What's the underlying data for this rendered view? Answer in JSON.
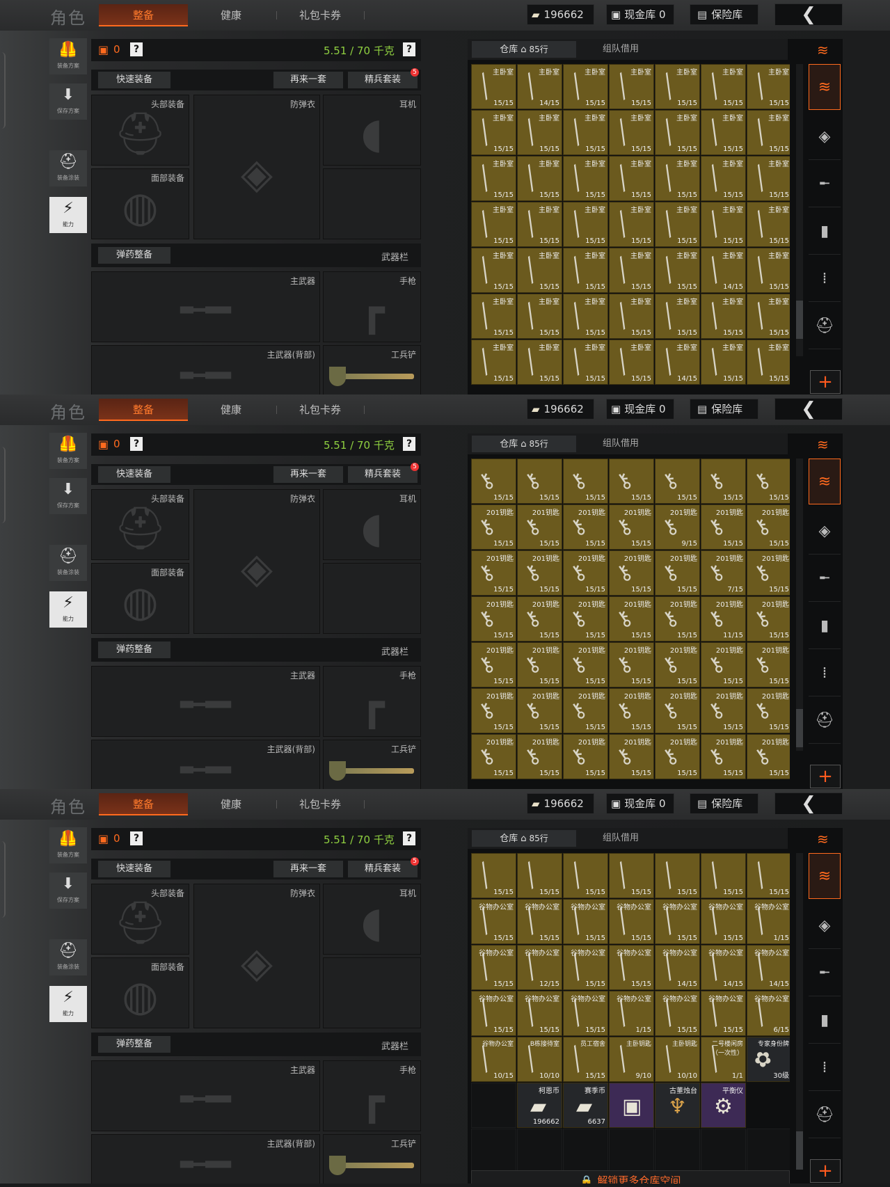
{
  "header": {
    "title": "角色",
    "tabs": [
      "整备",
      "健康",
      "礼包卡券"
    ],
    "currency": "196662",
    "cash_vault": "现金库 0",
    "safe_box": "保险库",
    "back_icon": "chevron-left-icon"
  },
  "sidebar": [
    {
      "label": "装备方案",
      "icon": "vest-icon"
    },
    {
      "label": "保存方案",
      "icon": "download-icon"
    },
    {
      "label": "装备涂装",
      "icon": "helmet-icon"
    },
    {
      "label": "能力",
      "icon": "ability-icon"
    }
  ],
  "loadout": {
    "value": "0",
    "help": "?",
    "weight": "5.51 / 70 千克",
    "quick_equip": "快速装备",
    "again": "再来一套",
    "elite": "精兵套装",
    "elite_badge": "5",
    "slots": {
      "head": "头部装备",
      "armor": "防弹衣",
      "ear": "耳机",
      "face": "面部装备",
      "weapon_bar": "武器栏",
      "ammo": "弹药整备",
      "primary": "主武器",
      "pistol": "手枪",
      "primary_back": "主武器(背部)",
      "shovel": "工兵铲"
    }
  },
  "inventory": {
    "tab_warehouse": "仓库",
    "rows": "85行",
    "tab_team": "组队借用",
    "unlock": "解锁更多仓库空间",
    "categories": [
      "layers-icon",
      "armor-icon",
      "rifle-icon",
      "magazine-icon",
      "ammo-icon",
      "helmet-icon"
    ]
  },
  "screens": [
    {
      "rows": [
        {
          "name": "主卧室",
          "counts": [
            "15/15",
            "14/15",
            "15/15",
            "15/15",
            "15/15",
            "15/15",
            "15/15"
          ]
        },
        {
          "name": "主卧室",
          "counts": [
            "15/15",
            "15/15",
            "15/15",
            "15/15",
            "15/15",
            "15/15",
            "15/15"
          ]
        },
        {
          "name": "主卧室",
          "counts": [
            "15/15",
            "15/15",
            "15/15",
            "15/15",
            "15/15",
            "15/15",
            "15/15"
          ]
        },
        {
          "name": "主卧室",
          "counts": [
            "15/15",
            "15/15",
            "15/15",
            "15/15",
            "15/15",
            "15/15",
            "15/15"
          ]
        },
        {
          "name": "主卧室",
          "counts": [
            "15/15",
            "15/15",
            "15/15",
            "15/15",
            "15/15",
            "14/15",
            "15/15"
          ]
        },
        {
          "name": "主卧室",
          "counts": [
            "15/15",
            "15/15",
            "15/15",
            "15/15",
            "15/15",
            "15/15",
            "15/15"
          ]
        },
        {
          "name": "主卧室",
          "counts": [
            "15/15",
            "15/15",
            "15/15",
            "15/15",
            "14/15",
            "15/15",
            "15/15"
          ]
        }
      ]
    },
    {
      "rows": [
        {
          "name": "",
          "counts": [
            "15/15",
            "15/15",
            "15/15",
            "15/15",
            "15/15",
            "15/15",
            "15/15"
          ]
        },
        {
          "name": "201钥匙",
          "counts": [
            "15/15",
            "15/15",
            "15/15",
            "15/15",
            "9/15",
            "15/15",
            "15/15"
          ]
        },
        {
          "name": "201钥匙",
          "counts": [
            "15/15",
            "15/15",
            "15/15",
            "15/15",
            "15/15",
            "7/15",
            "15/15"
          ]
        },
        {
          "name": "201钥匙",
          "counts": [
            "15/15",
            "15/15",
            "15/15",
            "15/15",
            "15/15",
            "11/15",
            "15/15"
          ]
        },
        {
          "name": "201钥匙",
          "counts": [
            "15/15",
            "15/15",
            "15/15",
            "15/15",
            "15/15",
            "15/15",
            "15/15"
          ]
        },
        {
          "name": "201钥匙",
          "counts": [
            "15/15",
            "15/15",
            "15/15",
            "15/15",
            "15/15",
            "15/15",
            "15/15"
          ]
        },
        {
          "name": "201钥匙",
          "counts": [
            "15/15",
            "15/15",
            "15/15",
            "15/15",
            "15/15",
            "15/15",
            "15/15"
          ]
        }
      ]
    },
    {
      "rows": [
        {
          "name": "",
          "counts": [
            "15/15",
            "15/15",
            "15/15",
            "15/15",
            "15/15",
            "15/15",
            "15/15"
          ]
        },
        {
          "name": "谷物办公室",
          "counts": [
            "15/15",
            "15/15",
            "15/15",
            "15/15",
            "15/15",
            "15/15",
            "1/15"
          ]
        },
        {
          "name": "谷物办公室",
          "counts": [
            "15/15",
            "12/15",
            "15/15",
            "15/15",
            "14/15",
            "14/15",
            "14/15"
          ]
        },
        {
          "name": "谷物办公室",
          "counts": [
            "15/15",
            "15/15",
            "15/15",
            "1/15",
            "15/15",
            "15/15",
            "6/15"
          ]
        }
      ],
      "special_row": [
        {
          "name": "谷物办公室",
          "count": "10/15"
        },
        {
          "name": "B栋接待室",
          "count": "10/10"
        },
        {
          "name": "员工宿舍",
          "count": "15/15"
        },
        {
          "name": "主卧钥匙",
          "count": "9/10"
        },
        {
          "name": "主卧钥匙",
          "count": "10/10"
        },
        {
          "name": "二号楼闲房（一次性）",
          "count": "1/1"
        },
        {
          "name": "专家身份牌",
          "count": "30级"
        }
      ],
      "misc_row": [
        {
          "name": "",
          "count": ""
        },
        {
          "name": "柯恩币",
          "count": "196662"
        },
        {
          "name": "赛季币",
          "count": "6637"
        },
        {
          "name": "",
          "count": ""
        },
        {
          "name": "古董烛台",
          "count": ""
        },
        {
          "name": "平衡仪",
          "count": ""
        }
      ]
    }
  ]
}
